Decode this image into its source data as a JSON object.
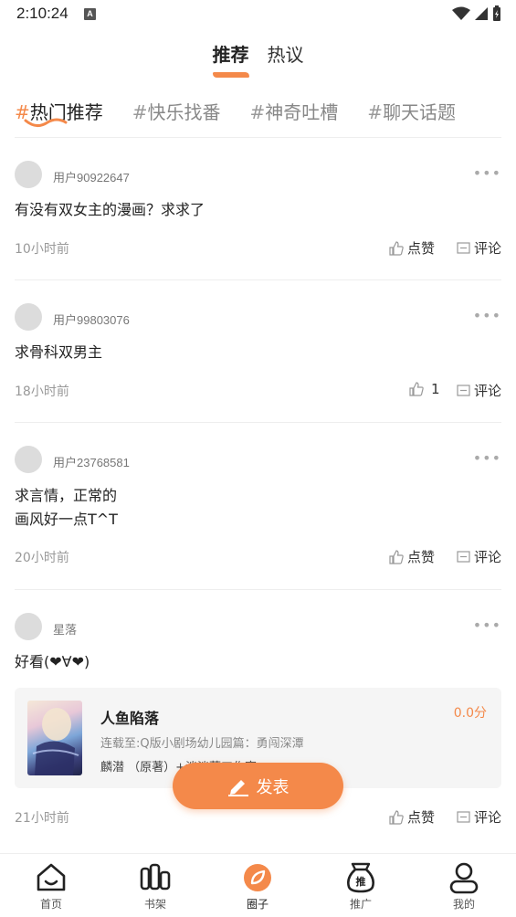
{
  "status": {
    "time": "2:10:24",
    "a_badge": "A"
  },
  "top_tabs": [
    {
      "label": "推荐",
      "active": true
    },
    {
      "label": "热议",
      "active": false
    }
  ],
  "topics": [
    {
      "hash": "#",
      "label": "热门推荐",
      "active": true
    },
    {
      "hash": "#",
      "label": "快乐找番",
      "active": false
    },
    {
      "hash": "#",
      "label": "神奇吐槽",
      "active": false
    },
    {
      "hash": "#",
      "label": "聊天话题",
      "active": false
    }
  ],
  "posts": [
    {
      "user": "用户90922647",
      "content": "有没有双女主的漫画？求求了",
      "time": "10小时前",
      "like": "点赞",
      "comment": "评论",
      "more": "•••"
    },
    {
      "user": "用户99803076",
      "content": "求骨科双男主",
      "time": "18小时前",
      "like": "1",
      "comment": "评论",
      "more": "•••"
    },
    {
      "user": "用户23768581",
      "content_line1": "求言情，正常的",
      "content_line2": "画风好一点T^T",
      "time": "20小时前",
      "like": "点赞",
      "comment": "评论",
      "more": "•••"
    },
    {
      "user": "星落",
      "content": "好看(❤∀❤)",
      "time": "21小时前",
      "like": "点赞",
      "comment": "评论",
      "more": "•••"
    }
  ],
  "book": {
    "title": "人鱼陷落",
    "score": "0.0分",
    "serial": "连载至:Q版小剧场幼儿园篇：勇闯深潭",
    "author": "麟潜 （原著）+淡淡藍工作室"
  },
  "fab": {
    "label": "发表"
  },
  "nav": [
    {
      "label": "首页",
      "icon": "home-icon"
    },
    {
      "label": "书架",
      "icon": "bookshelf-icon"
    },
    {
      "label": "圈子",
      "icon": "circle-icon",
      "active": true
    },
    {
      "label": "推广",
      "icon": "promote-bag-icon",
      "badge": "推"
    },
    {
      "label": "我的",
      "icon": "profile-icon"
    }
  ],
  "colors": {
    "accent": "#f4894a",
    "text": "#222222",
    "muted": "#999999",
    "card_bg": "#f5f5f5"
  }
}
